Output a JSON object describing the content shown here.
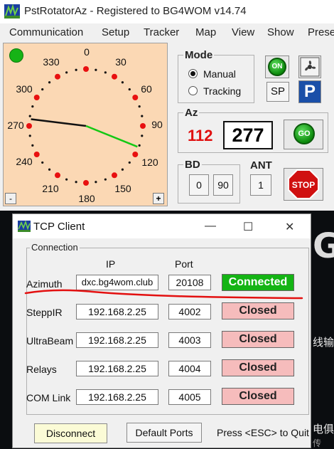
{
  "main_window": {
    "title": "PstRotatorAz - Registered to BG4WOM   v14.74",
    "menu": [
      "Communication",
      "Setup",
      "Tracker",
      "Map",
      "View",
      "Show",
      "Prese"
    ]
  },
  "dial": {
    "labels": [
      "0",
      "30",
      "60",
      "90",
      "120",
      "150",
      "180",
      "210",
      "240",
      "270",
      "300",
      "330"
    ],
    "minus_label": "-",
    "plus_label": "+"
  },
  "mode": {
    "title": "Mode",
    "options": [
      "Manual",
      "Tracking"
    ],
    "selected": "Manual"
  },
  "buttons": {
    "on": "ON",
    "sp": "SP",
    "p": "P",
    "go": "GO",
    "stop": "STOP"
  },
  "az": {
    "title": "Az",
    "current": "112",
    "target": "277"
  },
  "bd": {
    "title": "BD",
    "values": [
      "0",
      "90"
    ]
  },
  "ant": {
    "title": "ANT",
    "value": "1"
  },
  "tcp": {
    "title": "TCP Client",
    "controls": [
      "—",
      "☐",
      "✕"
    ],
    "group_title": "Connection",
    "col_ip": "IP",
    "col_port": "Port",
    "rows": [
      {
        "label": "Azimuth",
        "ip": "dxc.bg4wom.club",
        "port": "20108",
        "status": "Connected"
      },
      {
        "label": "SteppIR",
        "ip": "192.168.2.25",
        "port": "4002",
        "status": "Closed"
      },
      {
        "label": "UltraBeam",
        "ip": "192.168.2.25",
        "port": "4003",
        "status": "Closed"
      },
      {
        "label": "Relays",
        "ip": "192.168.2.25",
        "port": "4004",
        "status": "Closed"
      },
      {
        "label": "COM Link",
        "ip": "192.168.2.25",
        "port": "4005",
        "status": "Closed"
      }
    ],
    "disconnect": "Disconnect",
    "default_ports": "Default Ports",
    "esc_hint": "Press <ESC> to Quit"
  },
  "background": {
    "snippets": [
      "G",
      "线输",
      "电俱",
      "传"
    ]
  },
  "colors": {
    "dial_bg": "#fbd8b4",
    "connected": "#14b414",
    "closed": "#f6bcbc",
    "az_current": "#e01010"
  }
}
